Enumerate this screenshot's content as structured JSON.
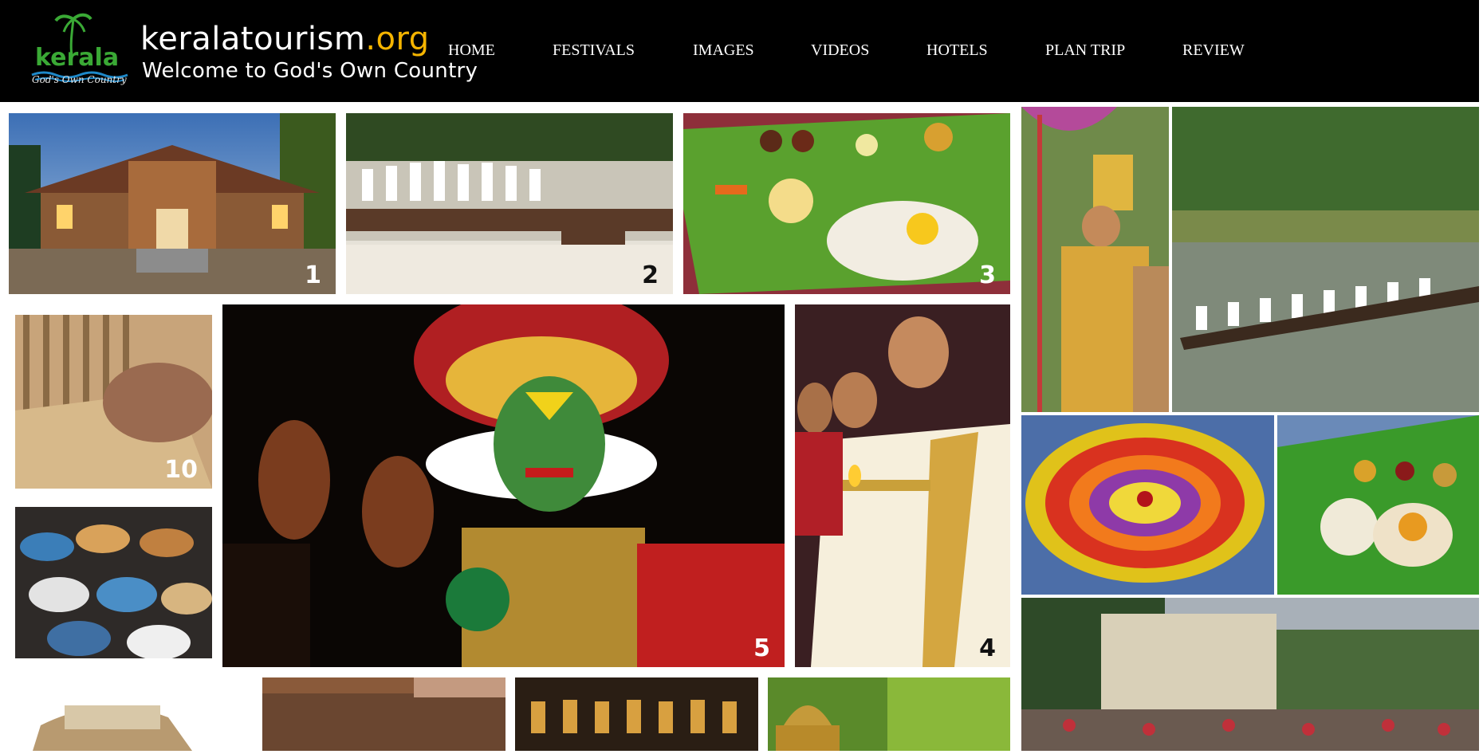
{
  "logo": {
    "emblem_text": "kerala",
    "tagline": "God's Own Country"
  },
  "site": {
    "name": "keralatourism",
    "tld": ".org",
    "welcome": "Welcome to God's Own Country"
  },
  "nav": {
    "items": [
      {
        "label": "HOME"
      },
      {
        "label": "FESTIVALS"
      },
      {
        "label": "IMAGES"
      },
      {
        "label": "VIDEOS"
      },
      {
        "label": "HOTELS"
      },
      {
        "label": "PLAN TRIP"
      },
      {
        "label": "REVIEW"
      }
    ]
  },
  "gallery": {
    "numbers": {
      "n1": "1",
      "n2": "2",
      "n3": "3",
      "n4": "4",
      "n5": "5",
      "n10": "10"
    },
    "photos": [
      "traditional-house",
      "snake-boat-rowers",
      "onam-sadya-leaf",
      "kathakali-dancer",
      "women-with-lamps",
      "mat-weaving",
      "handicraft-baskets",
      "mahabali-costume",
      "backwater-boat-race",
      "pookalam-flower-carpet",
      "banana-leaf-meal",
      "street-procession",
      "houseboat",
      "wooden-surface",
      "temple-festival-night",
      "brass-lamp-greenery"
    ]
  },
  "colors": {
    "header_bg": "#000000",
    "tld_accent": "#f5b400",
    "logo_green": "#3aa935",
    "logo_blue": "#1e88c8"
  }
}
